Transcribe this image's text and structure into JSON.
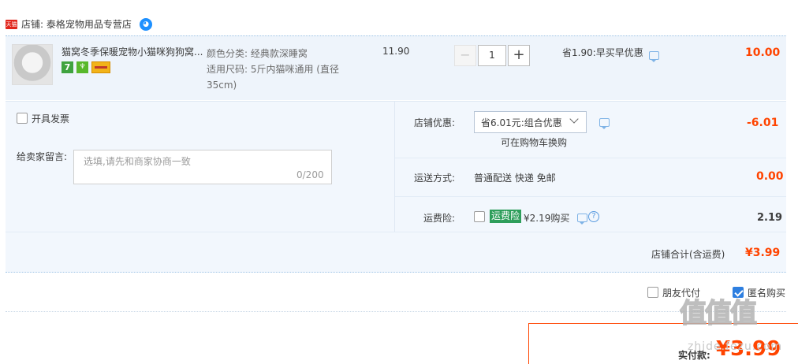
{
  "shop": {
    "badge": "天猫",
    "name": "店铺: 泰格宠物用品专营店"
  },
  "item": {
    "title": "猫窝冬季保暖宠物小猫咪狗狗窝...",
    "tag_7": "7",
    "sku_lines": [
      "颜色分类: 经典款深睡窝",
      "适用尺码: 5斤内猫咪通用 (直径",
      "35cm)"
    ],
    "unit_price": "11.90",
    "qty_minus": "−",
    "quantity": "1",
    "qty_plus": "+",
    "promo": "省1.90:早买早优惠",
    "subtotal": "10.00"
  },
  "options": {
    "invoice_label": "开具发票",
    "message_label": "给卖家留言:",
    "message_placeholder": "选填,请先和商家协商一致",
    "message_count": "0/200",
    "shop_discount_label": "店铺优惠:",
    "shop_discount_selected": "省6.01元:组合优惠",
    "shop_discount_note": "可在购物车换购",
    "shop_discount_amount": "-6.01",
    "shipping_label": "运送方式:",
    "shipping_value": "普通配送 快递 免邮",
    "shipping_amount": "0.00",
    "insurance_label": "运费险:",
    "insurance_badge": "运费险",
    "insurance_price": "¥2.19购买",
    "insurance_amount": "2.19",
    "help_glyph": "?",
    "shop_total_label": "店铺合计(含运费)",
    "shop_total_value": "¥3.99"
  },
  "bottom": {
    "friend_pay_label": "朋友代付",
    "anonymous_label": "匿名购买",
    "anonymous_checked": true,
    "pay_label": "实付款:",
    "pay_amount": "¥3.99"
  },
  "watermark": {
    "logo": "值值值",
    "url": "zhide.fezu.com"
  },
  "colors": {
    "accent": "#ff4400",
    "row_bg": "#eef4fb",
    "panel_bg": "#f2f7fd",
    "check_blue": "#2e7fe0",
    "insurance_green": "#2e9e5b"
  }
}
